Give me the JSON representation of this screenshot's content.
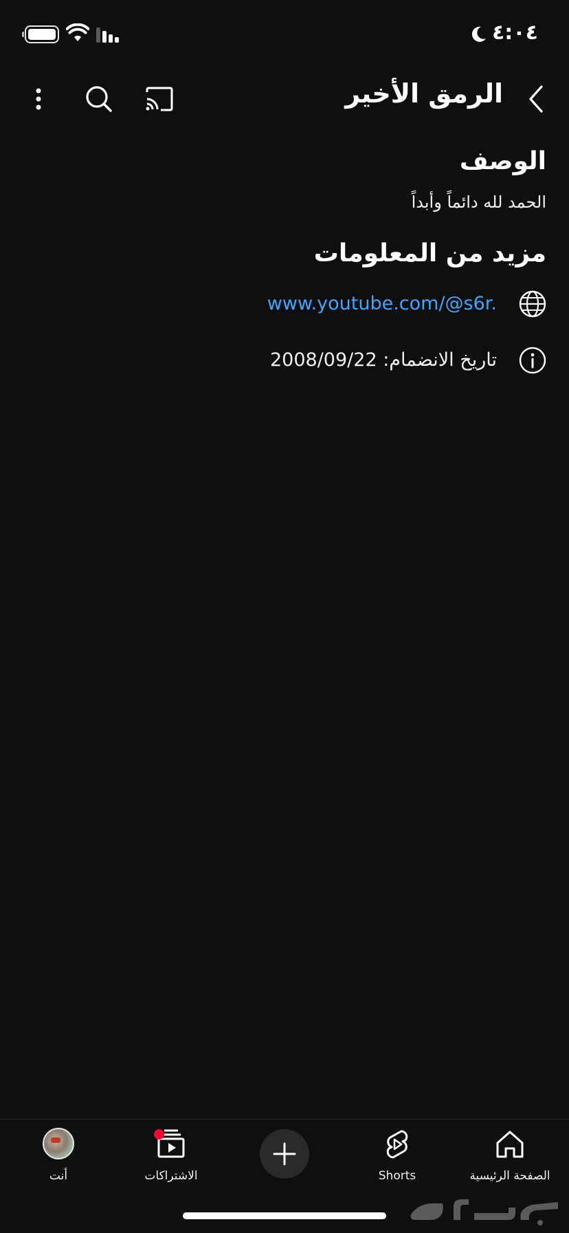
{
  "status_bar": {
    "time": "٤:٠٤",
    "icons": [
      "battery-icon",
      "wifi-icon",
      "cellular-signal-icon",
      "moon-icon"
    ]
  },
  "header": {
    "title": "الرمق الأخير",
    "icons": [
      "back-chevron-icon",
      "cast-icon",
      "search-icon",
      "more-vertical-icon"
    ]
  },
  "description": {
    "heading": "الوصف",
    "text": "الحمد لله دائماً وأبداً"
  },
  "more_info": {
    "heading": "مزيد من المعلومات",
    "link": {
      "icon": "globe-icon",
      "text": "www.youtube.com/@s6r."
    },
    "joined": {
      "icon": "info-icon",
      "text": "تاريخ الانضمام: 2008/09/22"
    }
  },
  "bottom_nav": {
    "items": [
      {
        "label": "الصفحة الرئيسية",
        "icon": "home-icon"
      },
      {
        "label": "Shorts",
        "icon": "shorts-icon"
      },
      {
        "label": "",
        "icon": "plus-icon"
      },
      {
        "label": "الاشتراكات",
        "icon": "subscriptions-icon"
      },
      {
        "label": "أنت",
        "icon": "avatar"
      }
    ]
  },
  "colors": {
    "background": "#0f0f0f",
    "text": "#f1f1f1",
    "link": "#3ea6ff",
    "notification": "#ff0033"
  },
  "watermark": {
    "text": "حراج"
  }
}
